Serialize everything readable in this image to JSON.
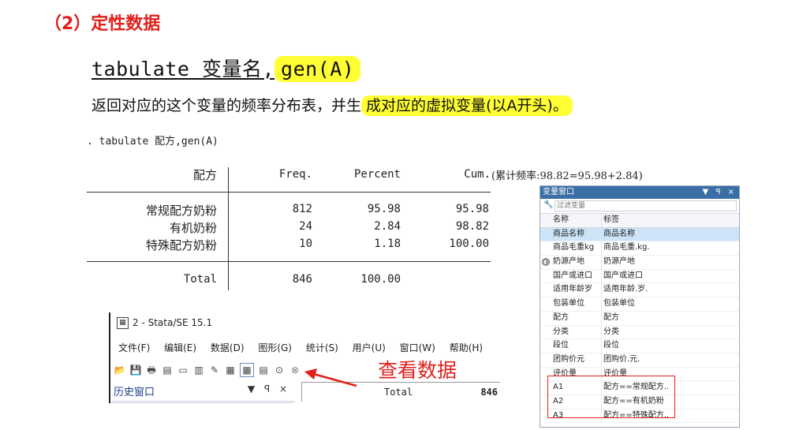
{
  "slide": {
    "heading": "（2）定性数据",
    "syntax": {
      "part1": "tabulate 变量名,",
      "part2": "gen(A)"
    },
    "description": {
      "plain": "返回对应的这个变量的频率分布表，并生",
      "highlight": "成对应的虚拟变量(以A开头)。"
    },
    "accent_color": "#e0201c",
    "highlight_color": "#ffff33"
  },
  "stata_output": {
    "command": ". tabulate 配方,gen(A)",
    "headers": {
      "var": "配方",
      "freq": "Freq.",
      "percent": "Percent",
      "cum": "Cum."
    },
    "cum_note": "(累计频率:98.82=95.98+2.84)",
    "rows": [
      {
        "label": "常规配方奶粉",
        "freq": "812",
        "percent": "95.98",
        "cum": "95.98"
      },
      {
        "label": "有机奶粉",
        "freq": "24",
        "percent": "2.84",
        "cum": "98.82"
      },
      {
        "label": "特殊配方奶粉",
        "freq": "10",
        "percent": "1.18",
        "cum": "100.00"
      }
    ],
    "total": {
      "label": "Total",
      "freq": "846",
      "percent": "100.00"
    }
  },
  "variables_window": {
    "title": "变量窗口",
    "controls": "▼ ꟼ ×",
    "filter_placeholder": "过滤变量",
    "col_name": "名称",
    "col_label": "标签",
    "rows": [
      {
        "name": "商品名称",
        "label": "商品名称"
      },
      {
        "name": "商品毛重kg",
        "label": "商品毛重.kg."
      },
      {
        "name": "奶源产地",
        "label": "奶源产地"
      },
      {
        "name": "国产或进口",
        "label": "国产或进口"
      },
      {
        "name": "适用年龄岁",
        "label": "适用年龄.岁."
      },
      {
        "name": "包装单位",
        "label": "包装单位"
      },
      {
        "name": "配方",
        "label": "配方"
      },
      {
        "name": "分类",
        "label": "分类"
      },
      {
        "name": "段位",
        "label": "段位"
      },
      {
        "name": "团购价元",
        "label": "团购价.元."
      },
      {
        "name": "评价量",
        "label": "评价量"
      },
      {
        "name": "A1",
        "label": "配方==常规配方..."
      },
      {
        "name": "A2",
        "label": "配方==有机奶粉"
      },
      {
        "name": "A3",
        "label": "配方==特殊配方..."
      }
    ]
  },
  "stata_window": {
    "title": "2 - Stata/SE 15.1",
    "menus": [
      "文件(F)",
      "编辑(E)",
      "数据(D)",
      "图形(G)",
      "统计(S)",
      "用户(U)",
      "窗口(W)",
      "帮助(H)"
    ],
    "history_label": "历史窗口",
    "history_controls": "▼ ꟼ ×",
    "results_total": "Total",
    "results_freq": "846"
  },
  "annotation": {
    "view_data": "查看数据"
  }
}
